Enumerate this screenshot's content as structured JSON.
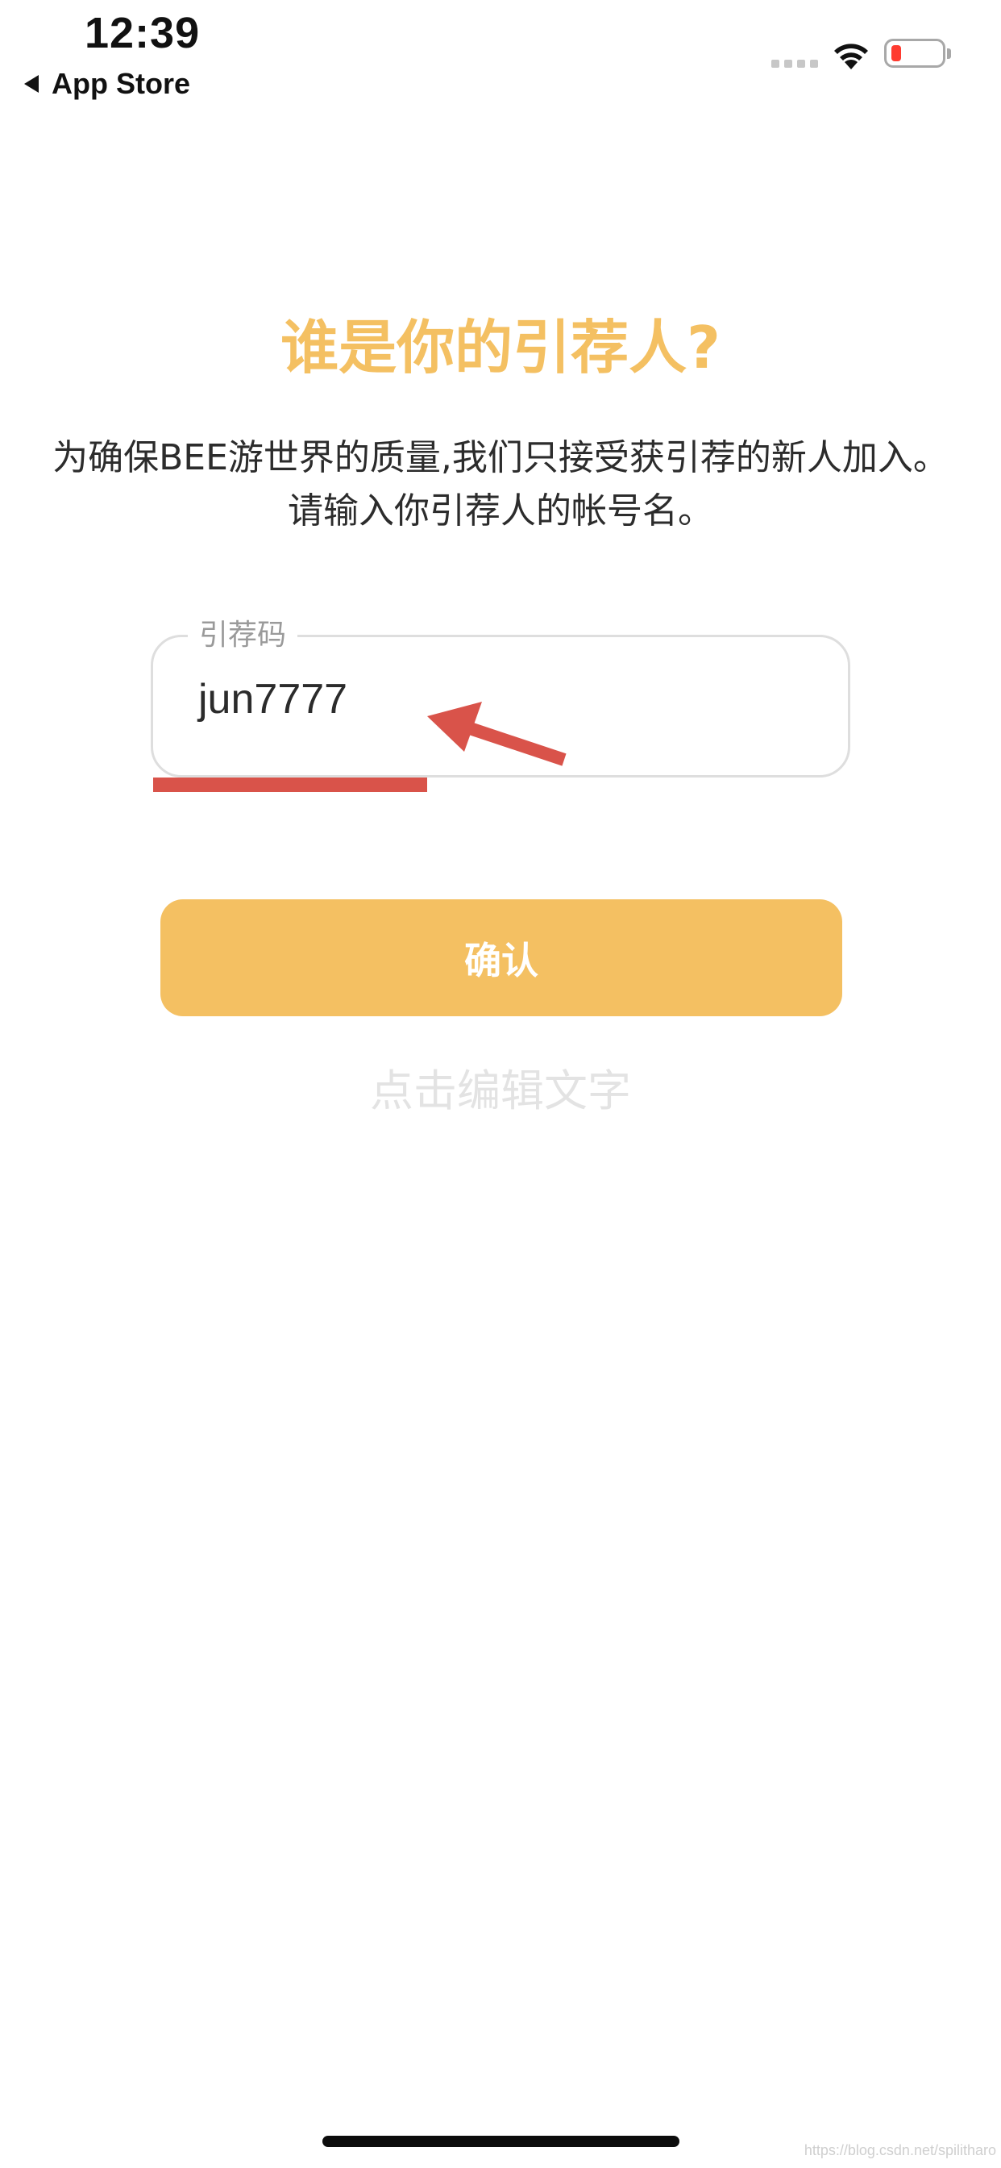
{
  "status_bar": {
    "time": "12:39",
    "back_label": "App Store",
    "battery_color": "#ff3b30"
  },
  "page": {
    "title": "谁是你的引荐人?",
    "description": "为确保BEE游世界的质量,我们只接受获引荐的新人加入。 请输入你引荐人的帐号名。"
  },
  "referral_input": {
    "label": "引荐码",
    "value": "jun7777"
  },
  "confirm_button": {
    "label": "确认"
  },
  "edit_hint": "点击编辑文字",
  "watermark": "https://blog.csdn.net/spilitharo",
  "colors": {
    "accent": "#f4c062",
    "annotation_red": "#d9534a",
    "input_border": "#dedede",
    "hint_text": "#e3e3e3"
  },
  "icons": {
    "back": "back-triangle-icon",
    "signal": "cellular-signal-icon",
    "wifi": "wifi-icon",
    "battery": "battery-icon",
    "annotation": "red-arrow-icon"
  }
}
